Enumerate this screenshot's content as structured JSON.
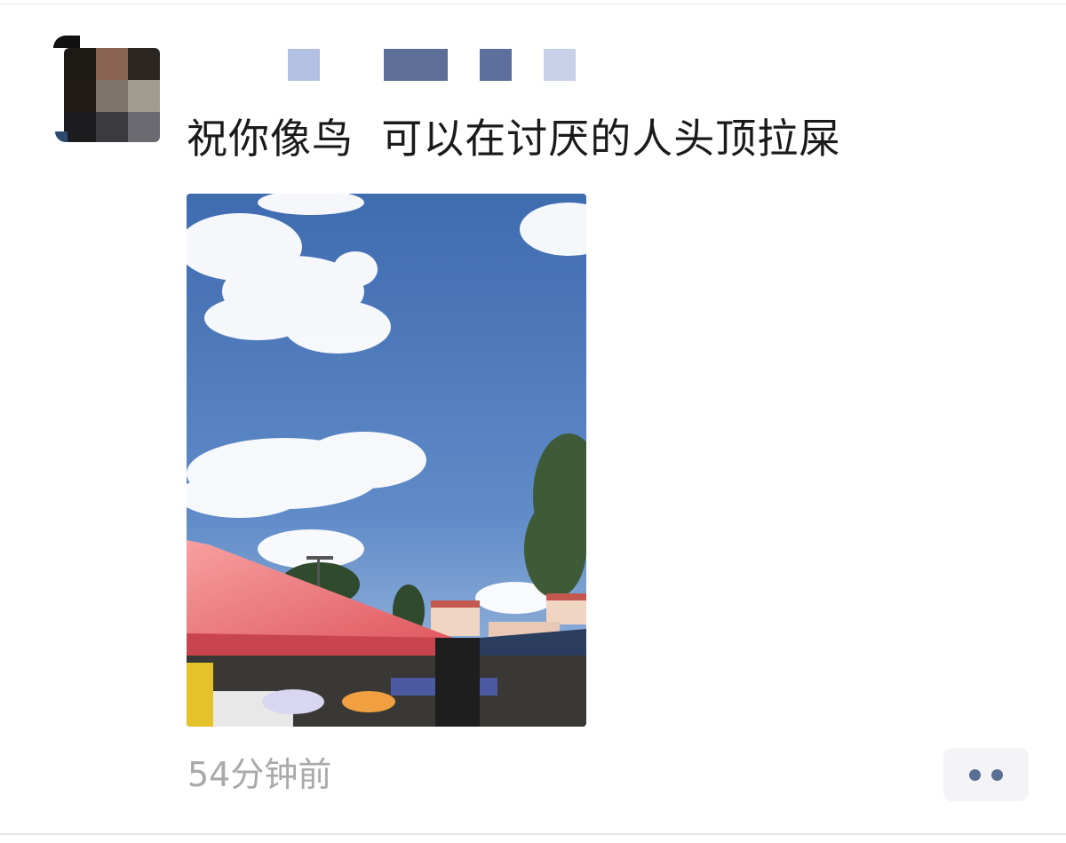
{
  "post": {
    "text": "祝你像鸟  可以在讨厌的人头顶拉屎",
    "timestamp": "54分钟前"
  },
  "author": {
    "name_mosaic_colors": [
      "#b2c1e1",
      "#5d6f96",
      "#5c6f9d",
      "#c7d0e8"
    ]
  },
  "avatar": {
    "mosaic_colors": [
      "#1b1a14",
      "#8a6453",
      "#2b2622",
      "#221c18",
      "#7d746c",
      "#a29b8f",
      "#1d1c1f",
      "#3a3a3f",
      "#6a6a70"
    ]
  },
  "photo": {
    "description_icon": "photo-sky-market",
    "colors": {
      "sky_top": "#3f6bb0",
      "sky_bottom": "#86a8d6",
      "tent": "#f07a7a",
      "tent_dark": "#d65a5e"
    }
  },
  "actions": {
    "more_icon": "more-dots-icon",
    "accent": "#5a6f94"
  }
}
